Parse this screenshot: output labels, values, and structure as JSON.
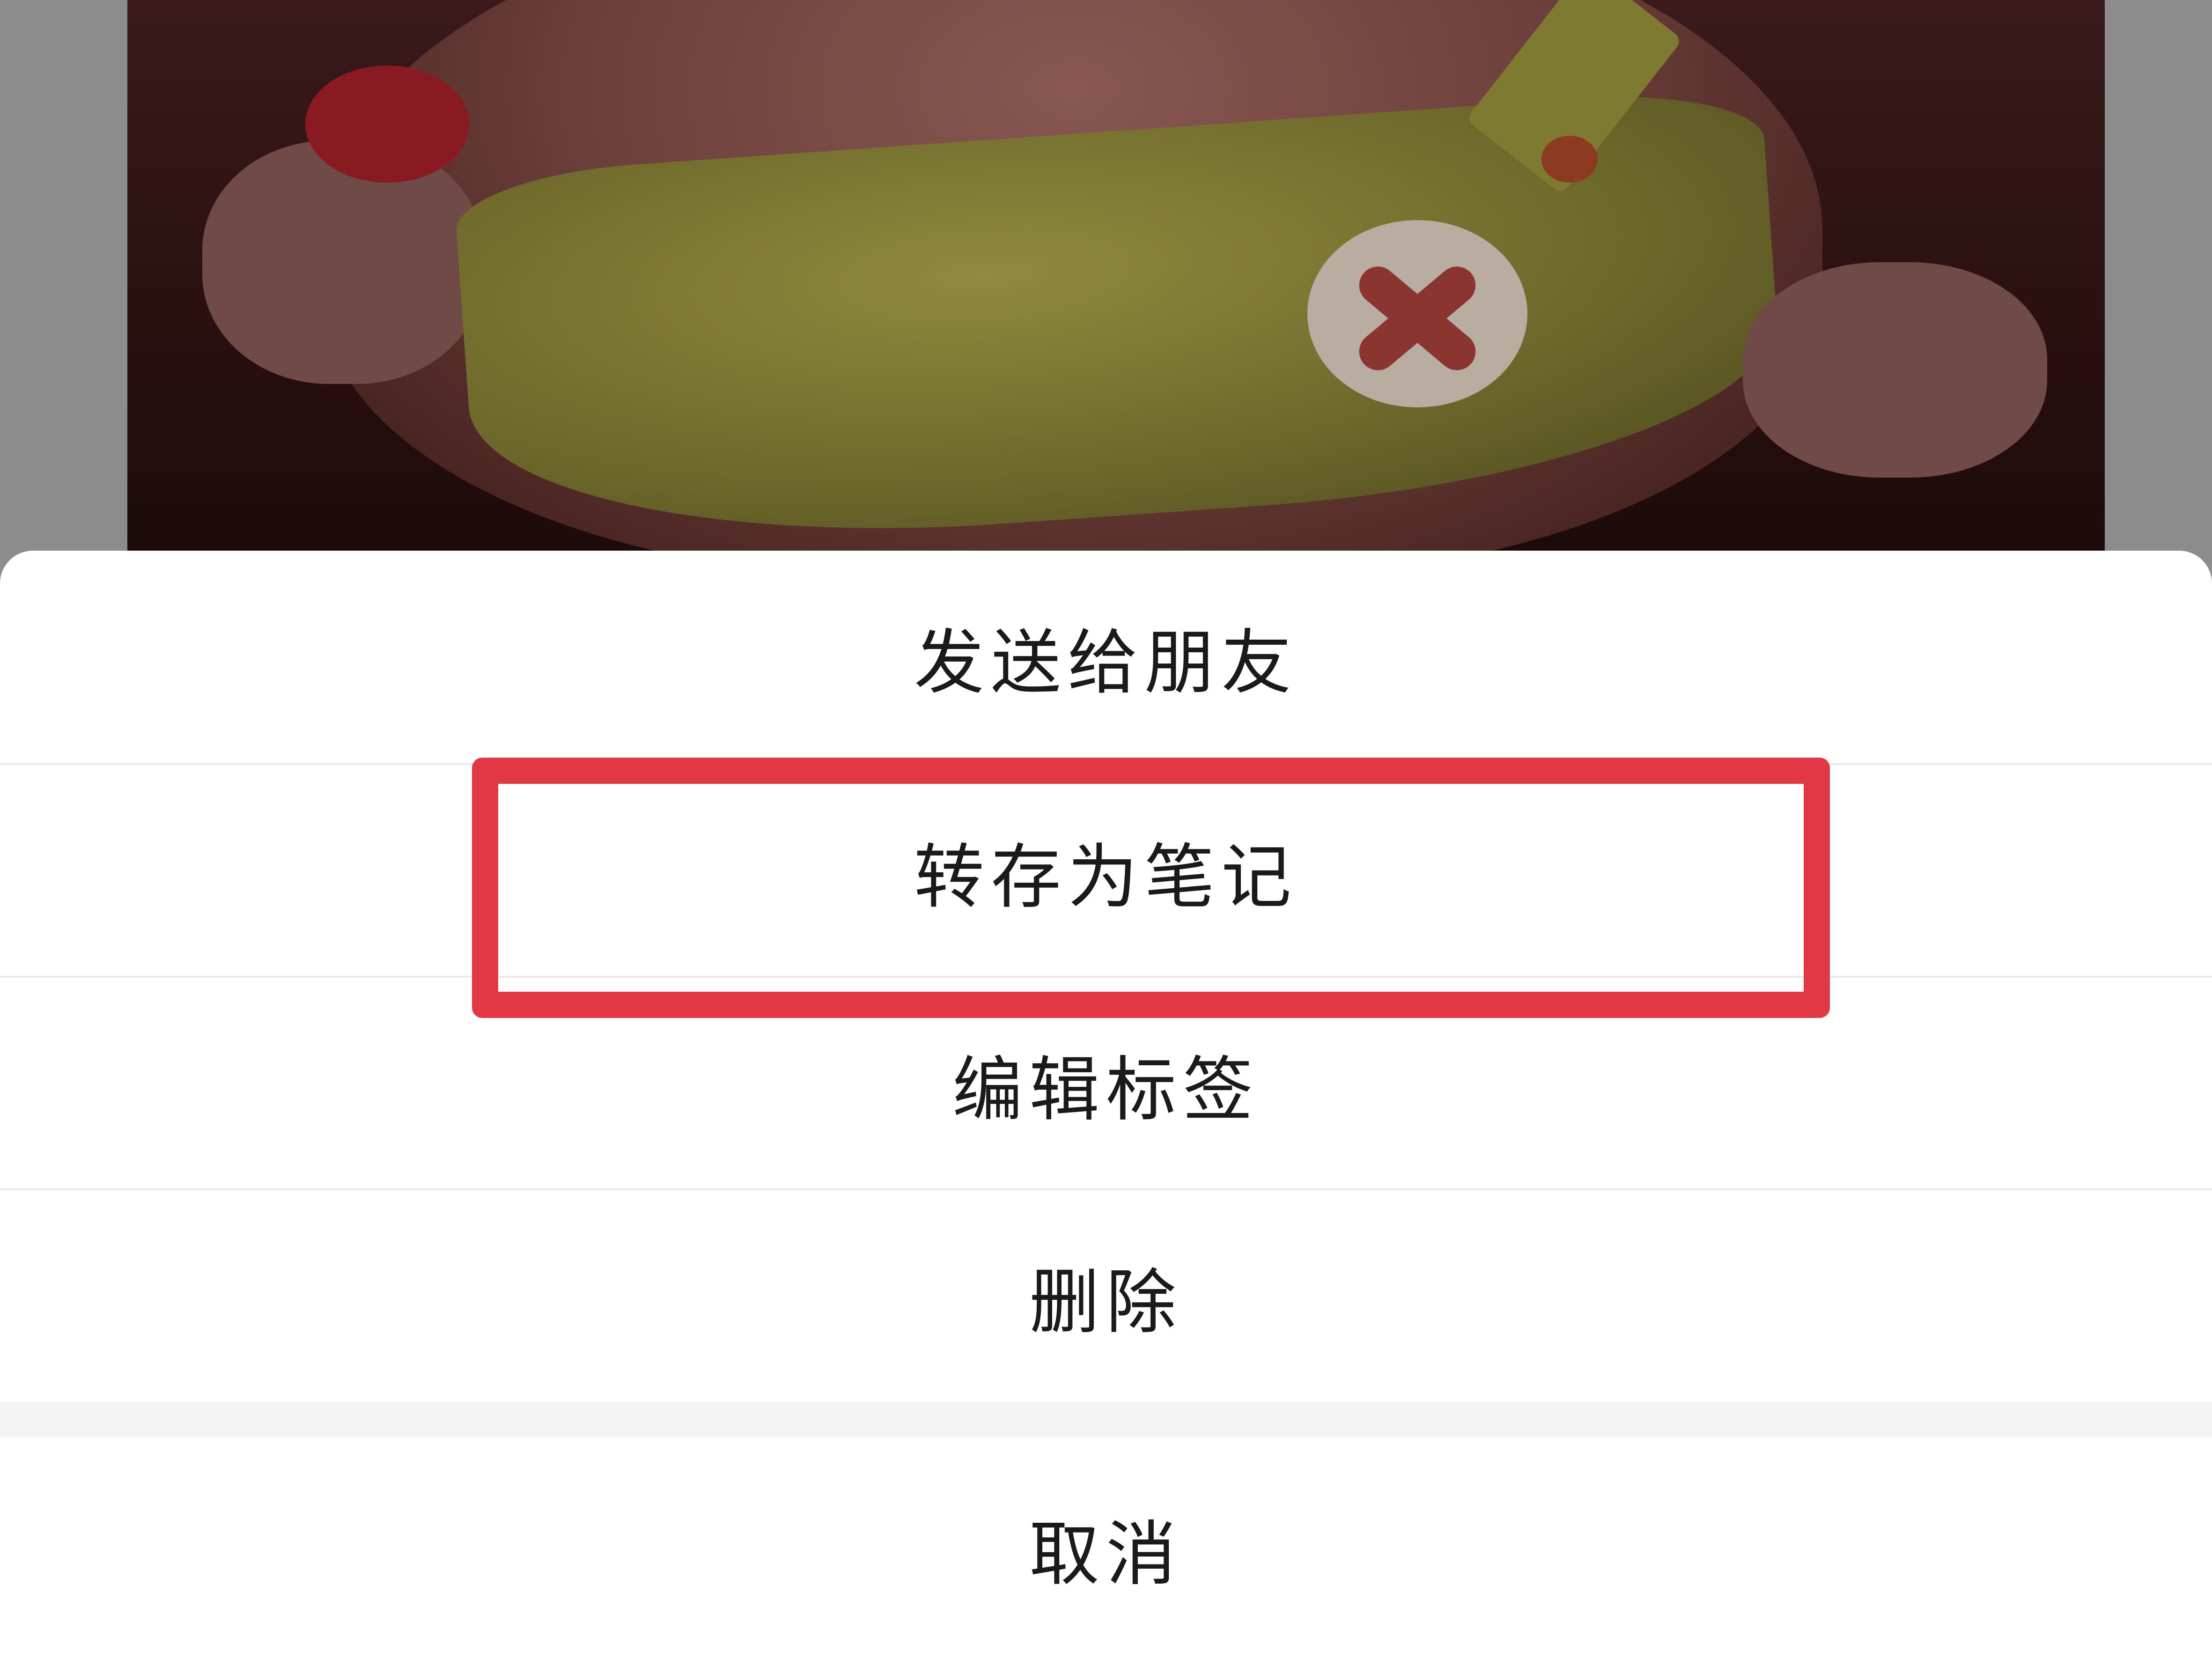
{
  "action_sheet": {
    "items": [
      {
        "label": "发送给朋友"
      },
      {
        "label": "转存为笔记"
      },
      {
        "label": "编辑标签"
      },
      {
        "label": "删除"
      }
    ],
    "cancel_label": "取消"
  },
  "highlight": {
    "color": "#e23744",
    "target": "转存为笔记"
  }
}
